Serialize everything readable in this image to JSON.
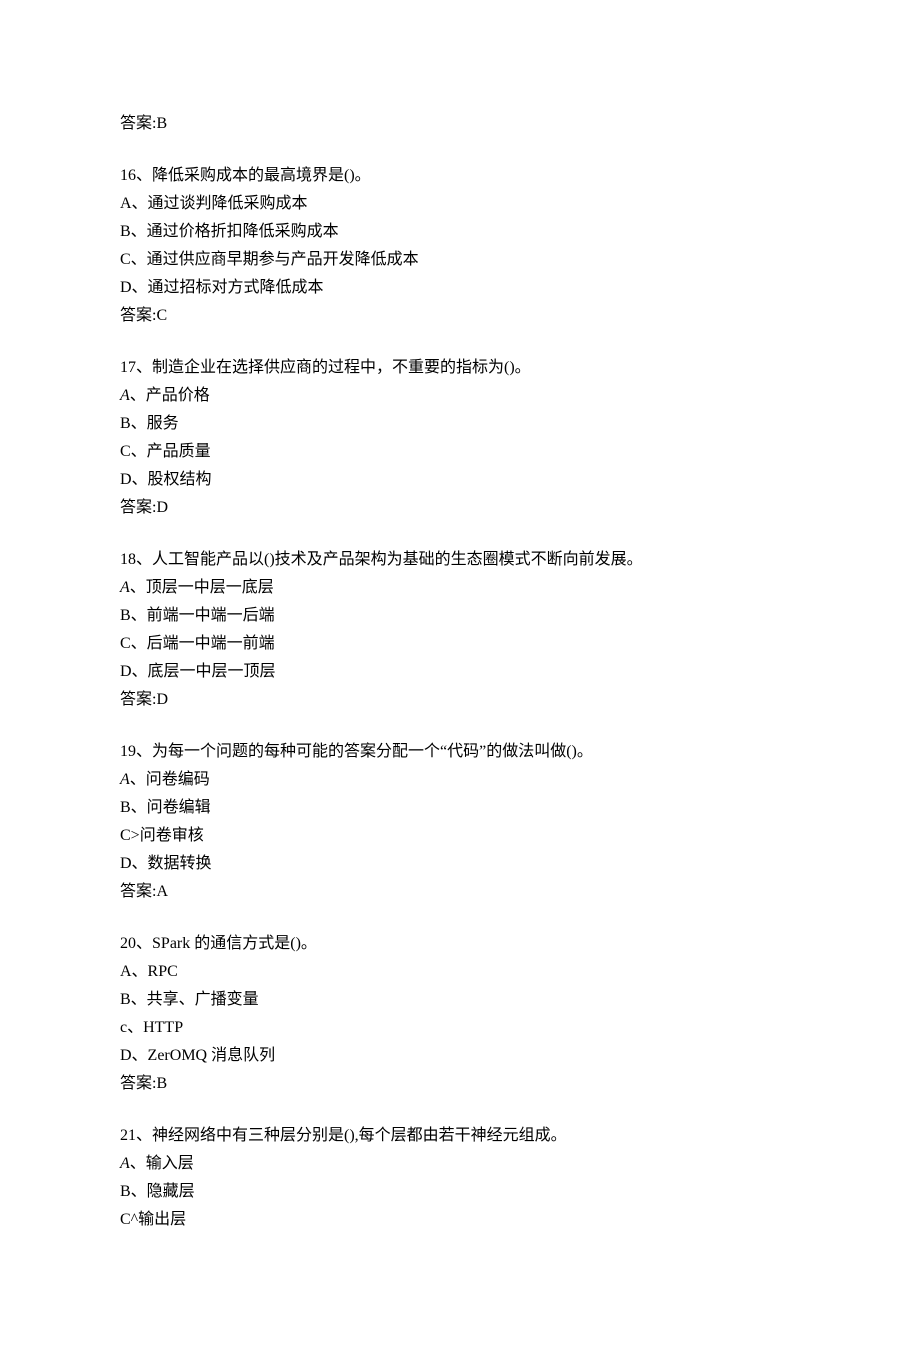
{
  "pre_answer": "答案:B",
  "questions": [
    {
      "num": "16",
      "stem": "降低采购成本的最高境界是()。",
      "options": [
        "A、通过谈判降低采购成本",
        "B、通过价格折扣降低采购成本",
        "C、通过供应商早期参与产品开发降低成本",
        "D、通过招标对方式降低成本"
      ],
      "answer": "答案:C"
    },
    {
      "num": "17",
      "stem": "制造企业在选择供应商的过程中，不重要的指标为()。",
      "options": [
        "A、产品价格",
        "B、服务",
        "C、产品质量",
        "D、股权结构"
      ],
      "answer": "答案:D",
      "first_italic": true
    },
    {
      "num": "18",
      "stem": "人工智能产品以()技术及产品架构为基础的生态圈模式不断向前发展。",
      "options": [
        "A、顶层一中层一底层",
        "B、前端一中端一后端",
        "C、后端一中端一前端",
        "D、底层一中层一顶层"
      ],
      "answer": "答案:D",
      "first_italic": true
    },
    {
      "num": "19",
      "stem": "为每一个问题的每种可能的答案分配一个“代码”的做法叫做()。",
      "options": [
        "A、问卷编码",
        "B、问卷编辑",
        "C>问卷审核",
        "D、数据转换"
      ],
      "answer": "答案:A",
      "first_italic": true
    },
    {
      "num": "20",
      "stem": "SPark 的通信方式是()。",
      "options": [
        "A、RPC",
        "B、共享、广播变量",
        "c、HTTP",
        "D、ZerOMQ 消息队列"
      ],
      "answer": "答案:B"
    },
    {
      "num": "21",
      "stem": "神经网络中有三种层分别是(),每个层都由若干神经元组成。",
      "options": [
        "A、输入层",
        "B、隐藏层",
        "C^输出层"
      ],
      "answer": "",
      "first_italic": true
    }
  ]
}
